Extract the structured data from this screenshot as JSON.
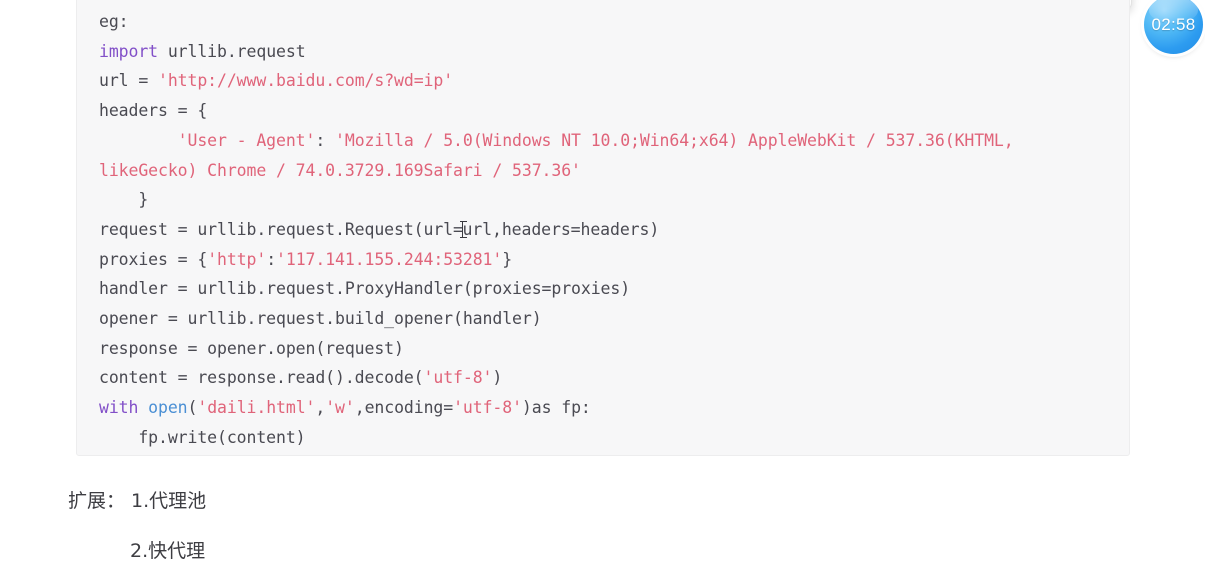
{
  "popup": {
    "text": "· · ·"
  },
  "timer": {
    "value": "02:58",
    "color": "#2d9cf0"
  },
  "code_block": {
    "background": "#f7f7f8",
    "language": "python",
    "lines": [
      {
        "id": "line-eg",
        "tokens": [
          {
            "t": "eg:",
            "c": "plain"
          }
        ]
      },
      {
        "id": "line-import",
        "tokens": [
          {
            "t": "import",
            "c": "kw"
          },
          {
            "t": " urllib.request",
            "c": "plain"
          }
        ]
      },
      {
        "id": "line-url",
        "tokens": [
          {
            "t": "url = ",
            "c": "plain"
          },
          {
            "t": "'http://www.baidu.com/s?wd=ip'",
            "c": "str"
          }
        ]
      },
      {
        "id": "line-headers",
        "tokens": [
          {
            "t": "headers = {",
            "c": "plain"
          }
        ]
      },
      {
        "id": "line-ua",
        "tokens": [
          {
            "t": "        ",
            "c": "plain"
          },
          {
            "t": "'User - Agent'",
            "c": "str"
          },
          {
            "t": ": ",
            "c": "plain"
          },
          {
            "t": "'Mozilla / 5.0(Windows NT 10.0;Win64;x64) AppleWebKit / 537.36(KHTML, likeGecko) Chrome / 74.0.3729.169Safari / 537.36'",
            "c": "str"
          }
        ]
      },
      {
        "id": "line-brace",
        "tokens": [
          {
            "t": "    }",
            "c": "plain"
          }
        ]
      },
      {
        "id": "line-request",
        "tokens": [
          {
            "t": "request = urllib.request.Request(url=",
            "c": "plain"
          },
          {
            "t": "CARET",
            "c": "caret"
          },
          {
            "t": "url,headers=headers)",
            "c": "plain"
          }
        ]
      },
      {
        "id": "line-proxies",
        "tokens": [
          {
            "t": "proxies = {",
            "c": "plain"
          },
          {
            "t": "'http'",
            "c": "str"
          },
          {
            "t": ":",
            "c": "plain"
          },
          {
            "t": "'117.141.155.244:53281'",
            "c": "str"
          },
          {
            "t": "}",
            "c": "plain"
          }
        ]
      },
      {
        "id": "line-handler",
        "tokens": [
          {
            "t": "handler = urllib.request.ProxyHandler(proxies=proxies)",
            "c": "plain"
          }
        ]
      },
      {
        "id": "line-opener",
        "tokens": [
          {
            "t": "opener = urllib.request.build_opener(handler)",
            "c": "plain"
          }
        ]
      },
      {
        "id": "line-response",
        "tokens": [
          {
            "t": "response = opener.open(request)",
            "c": "plain"
          }
        ]
      },
      {
        "id": "line-content",
        "tokens": [
          {
            "t": "content = response.read().decode(",
            "c": "plain"
          },
          {
            "t": "'utf-8'",
            "c": "str"
          },
          {
            "t": ")",
            "c": "plain"
          }
        ]
      },
      {
        "id": "line-with",
        "tokens": [
          {
            "t": "with ",
            "c": "kw"
          },
          {
            "t": "open",
            "c": "fn"
          },
          {
            "t": "(",
            "c": "plain"
          },
          {
            "t": "'daili.html'",
            "c": "str"
          },
          {
            "t": ",",
            "c": "plain"
          },
          {
            "t": "'w'",
            "c": "str"
          },
          {
            "t": ",encoding=",
            "c": "plain"
          },
          {
            "t": "'utf-8'",
            "c": "str"
          },
          {
            "t": ")as fp:",
            "c": "plain"
          }
        ]
      },
      {
        "id": "line-write",
        "tokens": [
          {
            "t": "    fp.write(content)",
            "c": "plain"
          }
        ]
      }
    ]
  },
  "notes": {
    "line1": "扩展： 1.代理池",
    "line2": "2.快代理"
  }
}
